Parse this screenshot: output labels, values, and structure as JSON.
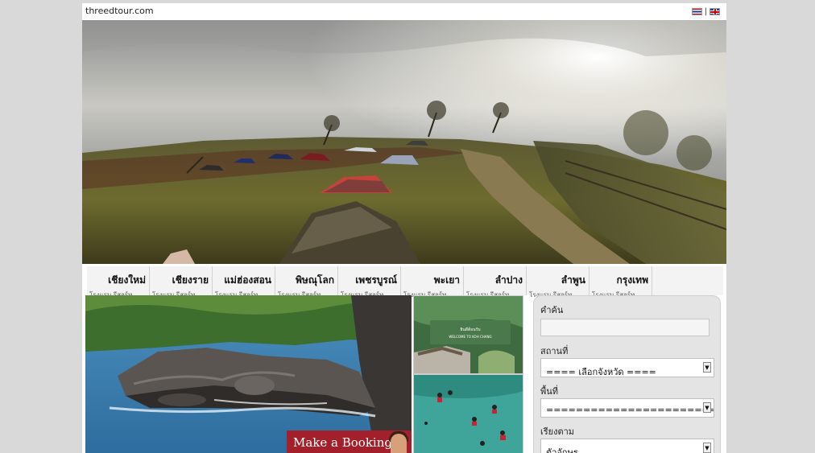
{
  "site": {
    "name": "threedtour.com"
  },
  "languages": {
    "separator": "|",
    "items": [
      "thai-flag-icon",
      "uk-flag-icon"
    ]
  },
  "nav": {
    "items": [
      {
        "label": "เชียงใหม่",
        "sub": "โรงแรม รีสอร์ท"
      },
      {
        "label": "เชียงราย",
        "sub": "โรงแรม รีสอร์ท"
      },
      {
        "label": "แม่ฮ่องสอน",
        "sub": "โรงแรม รีสอร์ท"
      },
      {
        "label": "พิษณุโลก",
        "sub": "โรงแรม รีสอร์ท"
      },
      {
        "label": "เพชรบูรณ์",
        "sub": "โรงแรม รีสอร์ท"
      },
      {
        "label": "พะเยา",
        "sub": "โรงแรม รีสอร์ท"
      },
      {
        "label": "ลำปาง",
        "sub": "โรงแรม รีสอร์ท"
      },
      {
        "label": "ลำพูน",
        "sub": "โรงแรม รีสอร์ท"
      },
      {
        "label": "กรุงเทพ",
        "sub": "โรงแรม รีสอร์ท"
      }
    ]
  },
  "banner": {
    "booking_label": "Make a Booking"
  },
  "thumbs": {
    "top_caption": "ยินดีต้อนรับ WELCOME TO KOH CHANG"
  },
  "search": {
    "keyword_label": "คำค้น",
    "keyword_value": "",
    "place_label": "สถานที่",
    "place_value": "==== เลือกจังหวัด ====",
    "area_label": "พื้นที่",
    "area_value": "========================",
    "sort_label": "เรียงตาม",
    "sort_value": "ตัวอักษร"
  }
}
